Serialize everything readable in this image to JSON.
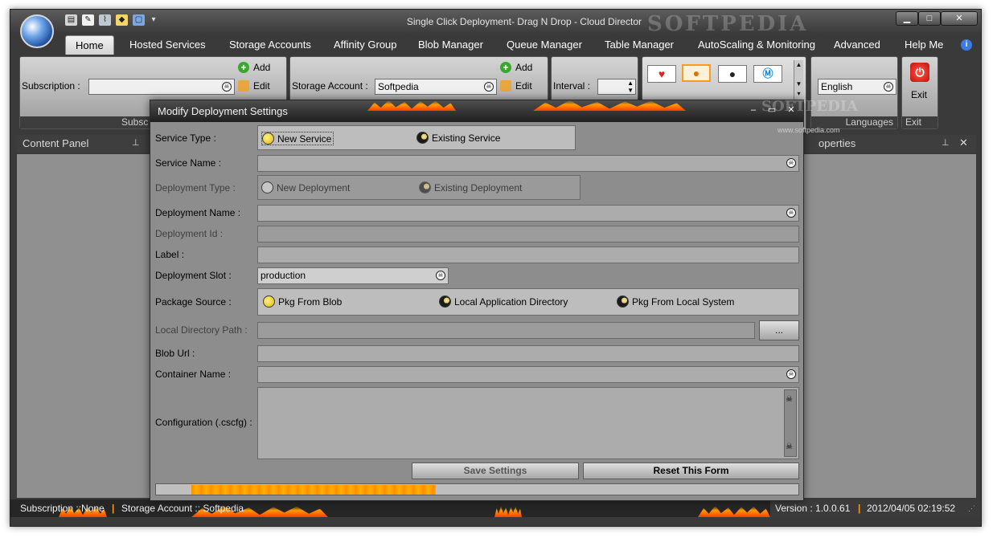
{
  "window": {
    "title": "Single Click Deployment- Drag N Drop - Cloud Director",
    "watermark": "SOFTPEDIA",
    "buttons": {
      "minimize": "▁",
      "maximize": "□",
      "close": "✕"
    }
  },
  "quick_access": [
    "clipboard-icon",
    "notepad-icon",
    "brush-icon",
    "tag-icon",
    "window-icon",
    "dropdown-arrow-icon"
  ],
  "tabs": [
    {
      "label": "Home",
      "active": true
    },
    {
      "label": "Hosted Services"
    },
    {
      "label": "Storage Accounts"
    },
    {
      "label": "Affinity Group"
    },
    {
      "label": "Blob Manager"
    },
    {
      "label": "Queue Manager"
    },
    {
      "label": "Table Manager"
    },
    {
      "label": "AutoScaling & Monitoring"
    },
    {
      "label": "Advanced"
    },
    {
      "label": "Help Me"
    }
  ],
  "ribbon": {
    "subscription_label": "Subscription :",
    "subscription_value": "",
    "subscription_footer": "Subsc",
    "add": "Add",
    "edit": "Edit",
    "storage_label": "Storage Account :",
    "storage_value": "Softpedia",
    "interval_label": "Interval :",
    "interval_value": "",
    "language_value": "English",
    "languages_footer": "Languages",
    "exit_label": "Exit",
    "exit_footer": "Exit"
  },
  "panels": {
    "content_panel": "Content Panel",
    "properties": "operties",
    "pin": "⊥",
    "close": "✕"
  },
  "dialog": {
    "title": "Modify Deployment Settings",
    "watermark": "SOFTPEDIA",
    "watermark_sub": "www.softpedia.com",
    "service_type_label": "Service Type :",
    "service_type_new": "New Service",
    "service_type_existing": "Existing Service",
    "service_name_label": "Service Name :",
    "service_name_value": "",
    "deployment_type_label": "Deployment Type :",
    "deployment_type_new": "New Deployment",
    "deployment_type_existing": "Existing Deployment",
    "deployment_name_label": "Deployment Name :",
    "deployment_name_value": "",
    "deployment_id_label": "Deployment Id :",
    "deployment_id_value": "",
    "label_label": "Label :",
    "label_value": "",
    "slot_label": "Deployment Slot :",
    "slot_value": "production",
    "package_source_label": "Package Source :",
    "pkg_blob": "Pkg From Blob",
    "pkg_local_app": "Local Application Directory",
    "pkg_local_system": "Pkg From Local System",
    "local_dir_label": "Local Directory Path :",
    "local_dir_value": "",
    "browse": "...",
    "blob_url_label": "Blob Url :",
    "blob_url_value": "",
    "container_label": "Container Name :",
    "container_value": "",
    "config_label": "Configuration (.cscfg) :",
    "config_value": "",
    "save": "Save Settings",
    "reset": "Reset This Form",
    "progress": 0.38
  },
  "status": {
    "subscription": "Subscription ::None",
    "storage": "Storage Account :: Softpedia",
    "version": "Version : 1.0.0.61",
    "datetime": "2012/04/05 02:19:52"
  }
}
